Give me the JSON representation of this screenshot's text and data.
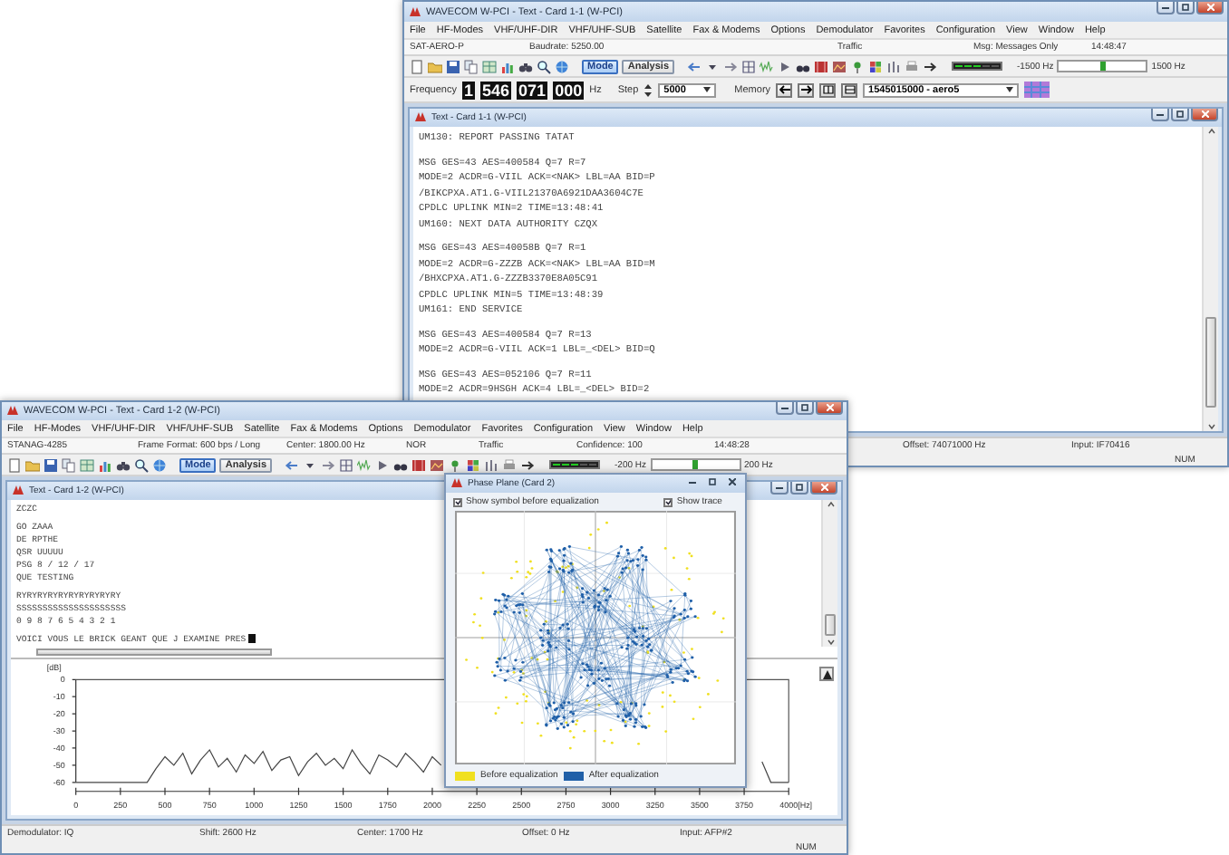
{
  "back_window": {
    "title": "WAVECOM W-PCI - Text - Card 1-1 (W-PCI)",
    "menu": [
      "File",
      "HF-Modes",
      "VHF/UHF-DIR",
      "VHF/UHF-SUB",
      "Satellite",
      "Fax & Modems",
      "Options",
      "Demodulator",
      "Favorites",
      "Configuration",
      "View",
      "Window",
      "Help"
    ],
    "status_fields": [
      "SAT-AERO-P",
      "Baudrate: 5250.00",
      "Traffic",
      "Msg: Messages Only",
      "14:48:47"
    ],
    "toolbar": {
      "buttons": [
        {
          "label": "Mode",
          "selected": true
        },
        {
          "label": "Analysis",
          "selected": false
        }
      ],
      "tuning": [
        "-1500 Hz",
        "1500 Hz"
      ]
    },
    "frequency_bar": {
      "label": "Frequency",
      "digits": [
        "1",
        "546",
        "071",
        "000"
      ],
      "unit": "Hz",
      "step_label": "Step",
      "step_value": "5000",
      "memory_label": "Memory",
      "memory_value": "1545015000 - aero5"
    },
    "text_window": {
      "title": "Text - Card 1-1 (W-PCI)",
      "paragraphs": [
        [
          "UM130: REPORT PASSING TATAT"
        ],
        [
          "MSG GES=43 AES=400584 Q=7 R=7",
          "MODE=2 ACDR=G-VIIL ACK=<NAK> LBL=AA BID=P",
          "/BIKCPXA.AT1.G-VIIL21370A6921DAA3604C7E",
          "CPDLC UPLINK MIN=2 TIME=13:48:41",
          "UM160: NEXT DATA AUTHORITY CZQX"
        ],
        [
          "MSG GES=43 AES=40058B Q=7 R=1",
          "MODE=2 ACDR=G-ZZZB ACK=<NAK> LBL=AA BID=M",
          "/BHXCPXA.AT1.G-ZZZB3370E8A05C91",
          "CPDLC UPLINK MIN=5 TIME=13:48:39",
          "UM161: END SERVICE"
        ],
        [
          "MSG GES=43 AES=400584 Q=7 R=13",
          "MODE=2 ACDR=G-VIIL ACK=1 LBL=_<DEL> BID=Q"
        ],
        [
          "MSG GES=43 AES=052106 Q=7 R=11",
          "MODE=2 ACDR=9HSGH ACK=4 LBL=_<DEL> BID=2"
        ]
      ]
    },
    "status_bar": [
      "Offset: 74071000 Hz",
      "Input: IF70416"
    ],
    "indicator": "NUM"
  },
  "front_window": {
    "title": "WAVECOM W-PCI - Text - Card 1-2 (W-PCI)",
    "menu": [
      "File",
      "HF-Modes",
      "VHF/UHF-DIR",
      "VHF/UHF-SUB",
      "Satellite",
      "Fax & Modems",
      "Options",
      "Demodulator",
      "Favorites",
      "Configuration",
      "View",
      "Window",
      "Help"
    ],
    "status_fields": [
      "STANAG-4285",
      "Frame Format: 600 bps / Long",
      "Center: 1800.00 Hz",
      "NOR",
      "Traffic",
      "Confidence: 100",
      "14:48:28"
    ],
    "toolbar": {
      "buttons": [
        {
          "label": "Mode",
          "selected": true
        },
        {
          "label": "Analysis",
          "selected": false
        }
      ],
      "tuning": [
        "-200 Hz",
        "200 Hz"
      ]
    },
    "text_window": {
      "title": "Text - Card 1-2 (W-PCI)",
      "paragraphs": [
        [
          "ZCZC"
        ],
        [
          "GO ZAAA",
          "DE RPTHE",
          "QSR UUUUU",
          "PSG 8 / 12 / 17",
          "QUE TESTING"
        ],
        [
          "RYRYRYRYRYRYRYRYRYRY",
          "SSSSSSSSSSSSSSSSSSSSS",
          "0 9 8 7 6 5 4 3 2 1"
        ],
        [
          "VOICI VOUS LE BRICK GEANT QUE J EXAMINE PRES"
        ]
      ]
    },
    "spectrum": {
      "chart_data": {
        "type": "line",
        "xlabel": "[Hz]",
        "ylabel": "[dB]",
        "xlim": [
          0,
          4000
        ],
        "ylim": [
          -60,
          0
        ],
        "xticks": [
          0,
          250,
          500,
          750,
          1000,
          1250,
          1500,
          1750,
          2000,
          2250,
          2500,
          2750,
          3000,
          3250,
          3500,
          3750,
          4000
        ],
        "yticks": [
          0,
          -10,
          -20,
          -30,
          -40,
          -50,
          -60
        ],
        "x": [
          0,
          50,
          100,
          150,
          200,
          250,
          300,
          350,
          400,
          450,
          500,
          550,
          600,
          650,
          700,
          750,
          800,
          850,
          900,
          950,
          1000,
          1050,
          1100,
          1150,
          1200,
          1250,
          1300,
          1350,
          1400,
          1450,
          1500,
          1550,
          1600,
          1650,
          1700,
          1750,
          1800,
          1850,
          1900,
          1950,
          2000,
          2050,
          2100,
          2150,
          2200,
          2250,
          2300,
          2350,
          2400,
          2450,
          2500,
          2550,
          2600,
          2650,
          2700,
          2750,
          2800,
          2850,
          2900,
          2950,
          3000,
          3050,
          3100,
          3150,
          3200,
          3250,
          3300,
          3350,
          3400,
          3450,
          3500,
          3550,
          3600,
          3650,
          3700,
          3750,
          3800,
          3850,
          3900,
          3950,
          4000
        ],
        "values": [
          -60,
          -60,
          -60,
          -60,
          -60,
          -60,
          -60,
          -60,
          -60,
          -52,
          -45,
          -50,
          -43,
          -55,
          -47,
          -41,
          -51,
          -46,
          -54,
          -44,
          -49,
          -42,
          -53,
          -47,
          -45,
          -56,
          -48,
          -43,
          -50,
          -46,
          -52,
          -41,
          -49,
          -55,
          -44,
          -47,
          -51,
          -43,
          -48,
          -54,
          -45,
          -50,
          null,
          null,
          null,
          null,
          null,
          null,
          null,
          null,
          null,
          null,
          null,
          null,
          null,
          null,
          null,
          null,
          null,
          null,
          null,
          null,
          null,
          null,
          null,
          null,
          null,
          null,
          null,
          null,
          null,
          null,
          null,
          null,
          null,
          null,
          null,
          -48,
          -60,
          -60,
          -60
        ]
      }
    },
    "status_bar": [
      "Demodulator: IQ",
      "Shift: 2600 Hz",
      "Center: 1700 Hz",
      "Offset: 0 Hz",
      "Input: AFP#2"
    ],
    "indicator": "NUM"
  },
  "phase_dialog": {
    "title": "Phase Plane (Card 2)",
    "options": [
      {
        "label": "Show symbol before equalization",
        "checked": true
      },
      {
        "label": "Show trace",
        "checked": true
      }
    ],
    "legend": [
      {
        "label": "Before equalization",
        "color": "#f0e020"
      },
      {
        "label": "After equalization",
        "color": "#1f5fa8"
      }
    ]
  }
}
